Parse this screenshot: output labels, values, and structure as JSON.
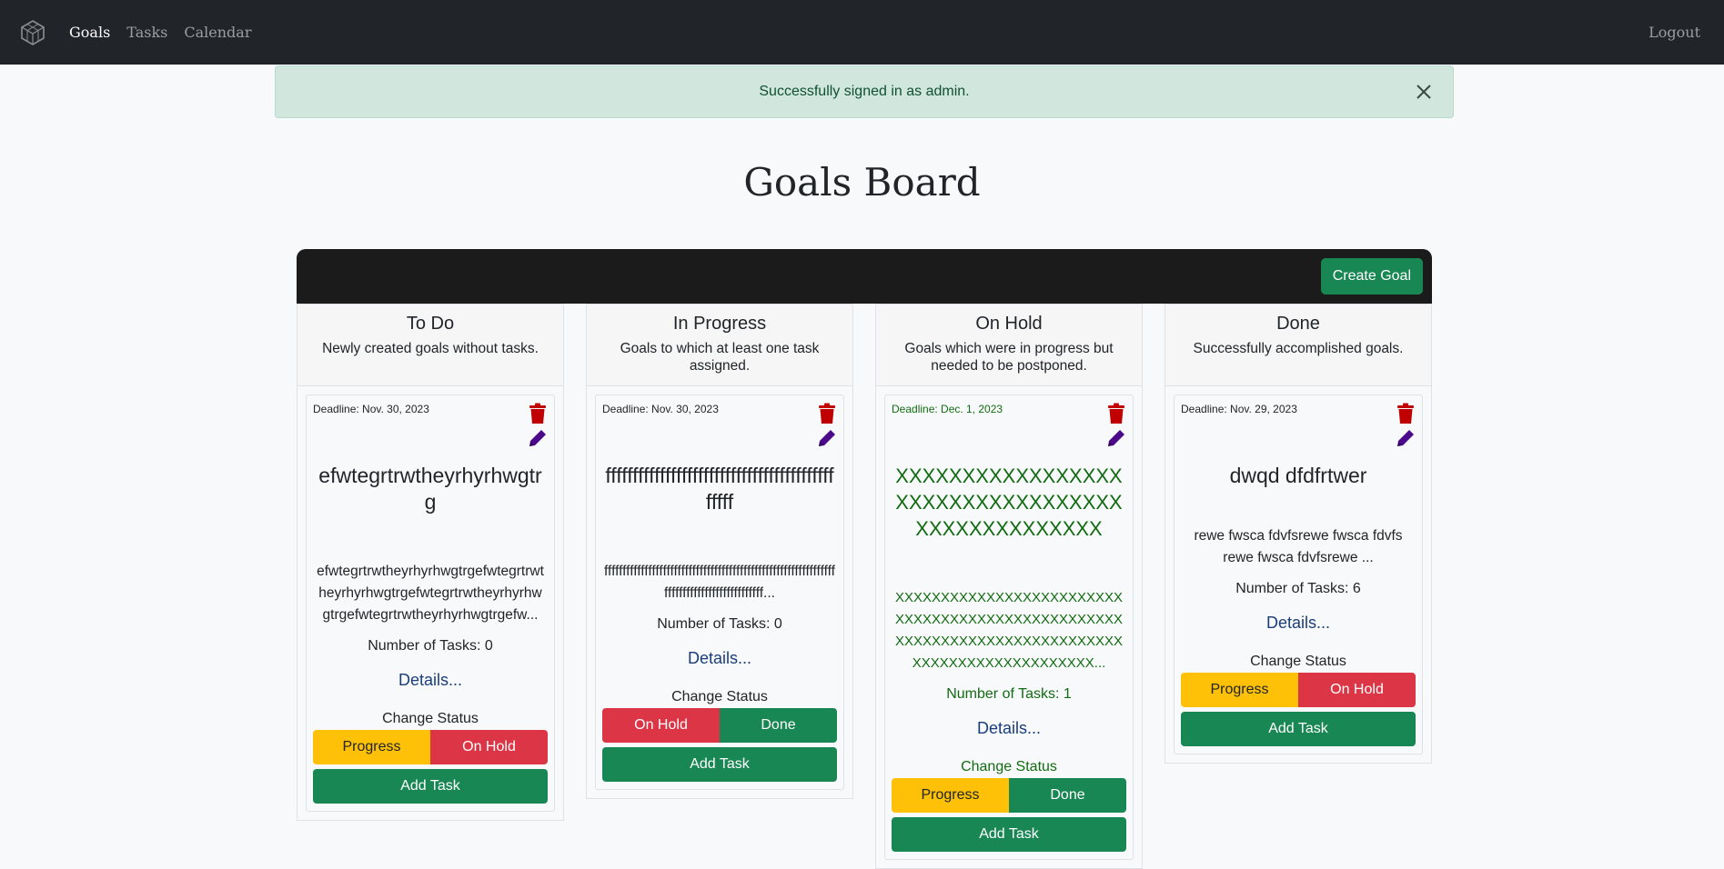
{
  "navbar": {
    "logo": "cube-logo-icon",
    "links": [
      {
        "label": "Goals",
        "active": true
      },
      {
        "label": "Tasks",
        "active": false
      },
      {
        "label": "Calendar",
        "active": false
      }
    ],
    "logout": "Logout"
  },
  "alert": {
    "message": "Successfully signed in as admin.",
    "close_icon": "close-icon"
  },
  "page_title": "Goals Board",
  "board": {
    "create_button": "Create Goal"
  },
  "columns": [
    {
      "title": "To Do",
      "description": "Newly created goals without tasks.",
      "card": {
        "deadline": "Deadline: Nov. 30, 2023",
        "title": "efwtegrtrwtheyrhyrhwgtrg",
        "description": "efwtegrtrwtheyrhyrhwgtrgefwtegrtrwtheyrhyrhwgtrgefwtegrtrwtheyrhyrhwgtrgefwtegrtrwtheyrhyrhwgtrgefw...",
        "tasks": "Number of Tasks: 0",
        "details": "Details...",
        "change_status": "Change Status",
        "status_buttons": [
          "Progress",
          "On Hold"
        ],
        "add_task": "Add Task"
      }
    },
    {
      "title": "In Progress",
      "description": "Goals to which at least one task assigned.",
      "card": {
        "deadline": "Deadline: Nov. 30, 2023",
        "title": "fffffffffffffffffffffffffffffffffffffffffffffff",
        "description": "ffffffffffffffffffffffffffffffffffffffffffffffffffffffffffffffffffffffffffffffffffffffffff...",
        "tasks": "Number of Tasks: 0",
        "details": "Details...",
        "change_status": "Change Status",
        "status_buttons": [
          "On Hold",
          "Done"
        ],
        "add_task": "Add Task"
      }
    },
    {
      "title": "On Hold",
      "description": "Goals which were in progress but needed to be postponed.",
      "card": {
        "deadline": "Deadline: Dec. 1, 2023",
        "title": "XXXXXXXXXXXXXXXXXXXXXXXXXXXXXXXXXXXXXXXXXXXXXXXX",
        "description": "XXXXXXXXXXXXXXXXXXXXXXXXXXXXXXXXXXXXXXXXXXXXXXXXXXXXXXXXXXXXXXXXXXXXXXXXXXXXXXXXXXXXXXXXXXXXXXX...",
        "tasks": "Number of Tasks: 1",
        "details": "Details...",
        "change_status": "Change Status",
        "status_buttons": [
          "Progress",
          "Done"
        ],
        "add_task": "Add Task"
      }
    },
    {
      "title": "Done",
      "description": "Successfully accomplished goals.",
      "card": {
        "deadline": "Deadline: Nov. 29, 2023",
        "title": "dwqd dfdfrtwer",
        "description": "rewe fwsca fdvfsrewe fwsca fdvfsrewe fwsca fdvfsrewe ...",
        "tasks": "Number of Tasks: 6",
        "details": "Details...",
        "change_status": "Change Status",
        "status_buttons": [
          "Progress",
          "On Hold"
        ],
        "add_task": "Add Task"
      }
    }
  ],
  "colors": {
    "navbar": "#212529",
    "success": "#198754",
    "warning": "#ffc107",
    "danger": "#dc3545",
    "overdue_text": "#126b12",
    "trash": "#c00000",
    "pencil": "#4b0a8a"
  }
}
